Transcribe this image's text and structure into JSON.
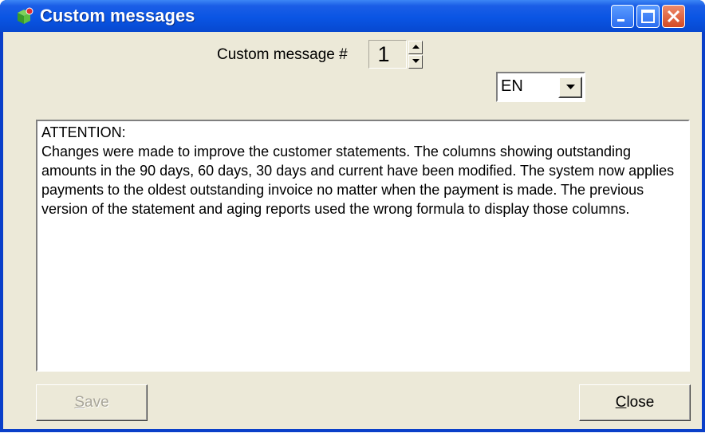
{
  "window": {
    "title": "Custom messages",
    "icon": "app-cube-icon"
  },
  "titlebar_buttons": {
    "minimize_icon": "minimize-icon",
    "maximize_icon": "maximize-icon",
    "close_icon": "close-icon"
  },
  "form": {
    "message_number_label": "Custom message #",
    "message_number_value": "1",
    "language_value": "EN"
  },
  "message": {
    "text": "ATTENTION:\nChanges were made to improve the customer statements. The columns showing outstanding amounts in the 90 days, 60 days, 30 days and current have been modified. The system now applies payments to the oldest outstanding invoice no matter when the payment is made. The previous version of the statement and aging reports used the wrong formula to display those columns."
  },
  "buttons": {
    "save_mnemonic": "S",
    "save_rest": "ave",
    "close_mnemonic": "C",
    "close_rest": "lose"
  },
  "colors": {
    "titlebar": "#0a55e4",
    "dialog_background": "#ece9d8",
    "close_button": "#d44a25"
  }
}
